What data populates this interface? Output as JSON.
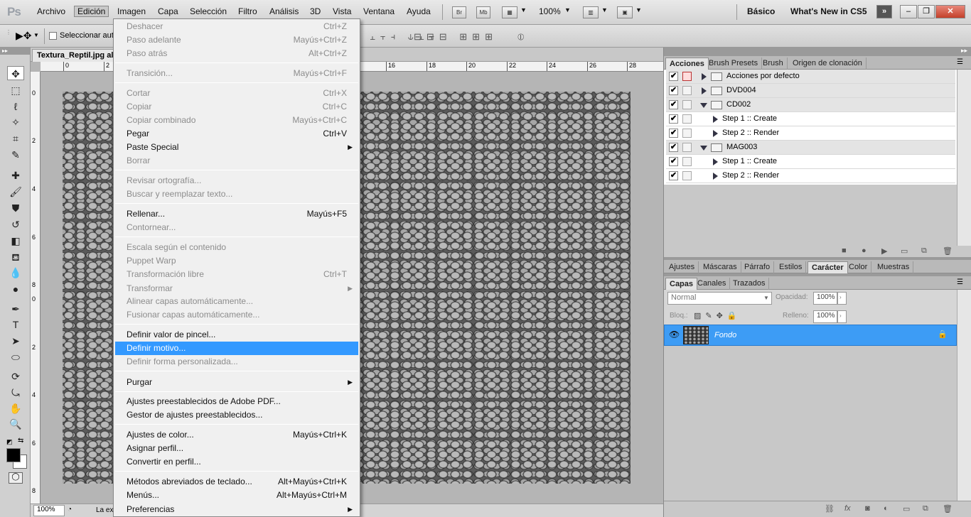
{
  "app": {
    "logo": "Ps"
  },
  "menubar": {
    "items": [
      "Archivo",
      "Edición",
      "Imagen",
      "Capa",
      "Selección",
      "Filtro",
      "Análisis",
      "3D",
      "Vista",
      "Ventana",
      "Ayuda"
    ],
    "br": "Br",
    "mb": "Mb",
    "zoom": "100%",
    "workspaces": [
      "Básico",
      "What's New in CS5"
    ]
  },
  "options": {
    "autoselect": "Seleccionar auto"
  },
  "document": {
    "tab": "Textura_Reptil.jpg al",
    "ruler_top": [
      "0",
      "2",
      "16",
      "18",
      "20",
      "22",
      "24",
      "26",
      "28"
    ],
    "ruler_left": [
      "0",
      "2",
      "4",
      "6",
      "8",
      "0",
      "2",
      "4",
      "6",
      "8"
    ],
    "status_zoom": "100%",
    "status_text": "La ex"
  },
  "edit_menu": {
    "items": [
      {
        "label": "Deshacer",
        "shortcut": "Ctrl+Z",
        "disabled": true
      },
      {
        "label": "Paso adelante",
        "shortcut": "Mayús+Ctrl+Z",
        "disabled": true
      },
      {
        "label": "Paso atrás",
        "shortcut": "Alt+Ctrl+Z",
        "disabled": true
      },
      {
        "label": "Transición...",
        "shortcut": "Mayús+Ctrl+F",
        "disabled": true
      },
      {
        "label": "Cortar",
        "shortcut": "Ctrl+X",
        "disabled": true
      },
      {
        "label": "Copiar",
        "shortcut": "Ctrl+C",
        "disabled": true
      },
      {
        "label": "Copiar combinado",
        "shortcut": "Mayús+Ctrl+C",
        "disabled": true
      },
      {
        "label": "Pegar",
        "shortcut": "Ctrl+V",
        "disabled": false
      },
      {
        "label": "Paste Special",
        "shortcut": "",
        "disabled": false,
        "submenu": true
      },
      {
        "label": "Borrar",
        "shortcut": "",
        "disabled": true
      },
      {
        "label": "Revisar ortografía...",
        "shortcut": "",
        "disabled": true
      },
      {
        "label": "Buscar y reemplazar texto...",
        "shortcut": "",
        "disabled": true
      },
      {
        "label": "Rellenar...",
        "shortcut": "Mayús+F5",
        "disabled": false
      },
      {
        "label": "Contornear...",
        "shortcut": "",
        "disabled": true
      },
      {
        "label": "Escala según el contenido",
        "shortcut": "",
        "disabled": true
      },
      {
        "label": "Puppet Warp",
        "shortcut": "",
        "disabled": true
      },
      {
        "label": "Transformación libre",
        "shortcut": "Ctrl+T",
        "disabled": true
      },
      {
        "label": "Transformar",
        "shortcut": "",
        "disabled": true,
        "submenu": true
      },
      {
        "label": "Alinear capas automáticamente...",
        "shortcut": "",
        "disabled": true
      },
      {
        "label": "Fusionar capas automáticamente...",
        "shortcut": "",
        "disabled": true
      },
      {
        "label": "Definir valor de pincel...",
        "shortcut": "",
        "disabled": false
      },
      {
        "label": "Definir motivo...",
        "shortcut": "",
        "disabled": false,
        "highlighted": true
      },
      {
        "label": "Definir forma personalizada...",
        "shortcut": "",
        "disabled": true
      },
      {
        "label": "Purgar",
        "shortcut": "",
        "disabled": false,
        "submenu": true
      },
      {
        "label": "Ajustes preestablecidos de Adobe PDF...",
        "shortcut": "",
        "disabled": false
      },
      {
        "label": "Gestor de ajustes preestablecidos...",
        "shortcut": "",
        "disabled": false
      },
      {
        "label": "Ajustes de color...",
        "shortcut": "Mayús+Ctrl+K",
        "disabled": false
      },
      {
        "label": "Asignar perfil...",
        "shortcut": "",
        "disabled": false
      },
      {
        "label": "Convertir en perfil...",
        "shortcut": "",
        "disabled": false
      },
      {
        "label": "Métodos abreviados de teclado...",
        "shortcut": "Alt+Mayús+Ctrl+K",
        "disabled": false
      },
      {
        "label": "Menús...",
        "shortcut": "Alt+Mayús+Ctrl+M",
        "disabled": false
      },
      {
        "label": "Preferencias",
        "shortcut": "",
        "disabled": false,
        "submenu": true
      }
    ]
  },
  "actions_panel": {
    "tabs": [
      "Acciones",
      "Brush Presets",
      "Brush",
      "Origen de clonación"
    ],
    "rows": [
      {
        "label": "Acciones por defecto",
        "type": "set",
        "expanded": false
      },
      {
        "label": "DVD004",
        "type": "set",
        "expanded": false
      },
      {
        "label": "CD002",
        "type": "set",
        "expanded": true
      },
      {
        "label": "Step 1 :: Create",
        "type": "action"
      },
      {
        "label": "Step 2 :: Render",
        "type": "action"
      },
      {
        "label": "MAG003",
        "type": "set",
        "expanded": true
      },
      {
        "label": "Step 1 :: Create",
        "type": "action"
      },
      {
        "label": "Step 2 :: Render",
        "type": "action"
      }
    ]
  },
  "adjust_panel": {
    "tabs": [
      "Ajustes",
      "Máscaras",
      "Párrafo",
      "Estilos",
      "Carácter",
      "Color",
      "Muestras"
    ]
  },
  "layers_panel": {
    "tabs": [
      "Capas",
      "Canales",
      "Trazados"
    ],
    "blend_mode": "Normal",
    "opacity_label": "Opacidad:",
    "opacity": "100%",
    "lock_label": "Bloq.:",
    "fill_label": "Relleno:",
    "fill": "100%",
    "layer_name": "Fondo"
  },
  "colors": {
    "highlight": "#3399ff",
    "layer_selected": "#3d9cf5"
  }
}
